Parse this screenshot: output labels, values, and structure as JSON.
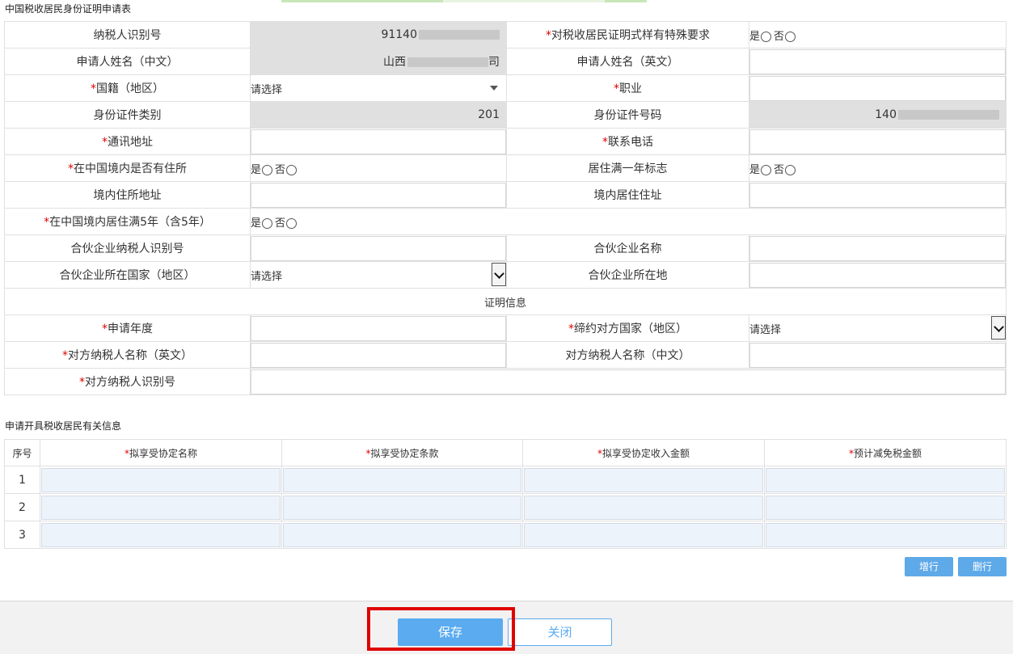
{
  "form": {
    "title": "中国税收居民身份证明申请表"
  },
  "row1": {
    "taxpayer_id_label": "纳税人识别号",
    "taxpayer_id_value": "91140",
    "special_req_label": "对税收居民证明式样有特殊要求"
  },
  "row2": {
    "name_cn_label": "申请人姓名（中文）",
    "name_cn_prefix": "山西",
    "name_cn_suffix": "司",
    "name_en_label": "申请人姓名（英文）"
  },
  "row3": {
    "nationality_label": "国籍（地区）",
    "nationality_value": "请选择",
    "occupation_label": "职业"
  },
  "row4": {
    "id_type_label": "身份证件类别",
    "id_type_value": "201",
    "id_no_label": "身份证件号码",
    "id_no_value": "140"
  },
  "row5": {
    "address_label": "通讯地址",
    "phone_label": "联系电话"
  },
  "row6": {
    "domicile_label": "在中国境内是否有住所",
    "one_year_label": "居住满一年标志"
  },
  "row7": {
    "domicile_addr_label": "境内住所地址",
    "residence_addr_label": "境内居住住址"
  },
  "row8": {
    "five_years_label": "在中国境内居住满5年（含5年）"
  },
  "row9": {
    "partner_id_label": "合伙企业纳税人识别号",
    "partner_name_label": "合伙企业名称"
  },
  "row10": {
    "partner_country_label": "合伙企业所在国家（地区）",
    "partner_country_value": "请选择",
    "partner_location_label": "合伙企业所在地"
  },
  "cert_section": {
    "title": "证明信息"
  },
  "row11": {
    "year_label": "申请年度",
    "treaty_country_label": "缔约对方国家（地区）",
    "treaty_country_value": "请选择"
  },
  "row12": {
    "other_name_en_label": "对方纳税人名称（英文）",
    "other_name_cn_label": "对方纳税人名称（中文）"
  },
  "row13": {
    "other_id_label": "对方纳税人识别号"
  },
  "radio": {
    "yes": "是",
    "no": "否"
  },
  "required_mark": "*",
  "info": {
    "title": "申请开具税收居民有关信息",
    "headers": [
      "序号",
      "拟享受协定名称",
      "拟享受协定条款",
      "拟享受协定收入金额",
      "预计减免税金额"
    ],
    "rows": [
      "1",
      "2",
      "3"
    ]
  },
  "buttons": {
    "add_row": "增行",
    "delete_row": "删行",
    "save": "保存",
    "close": "关闭"
  },
  "colors": {
    "accent": "#5aabf0",
    "highlight": "#e00000",
    "readonly": "#e0e0e0",
    "required": "#dd0000"
  }
}
